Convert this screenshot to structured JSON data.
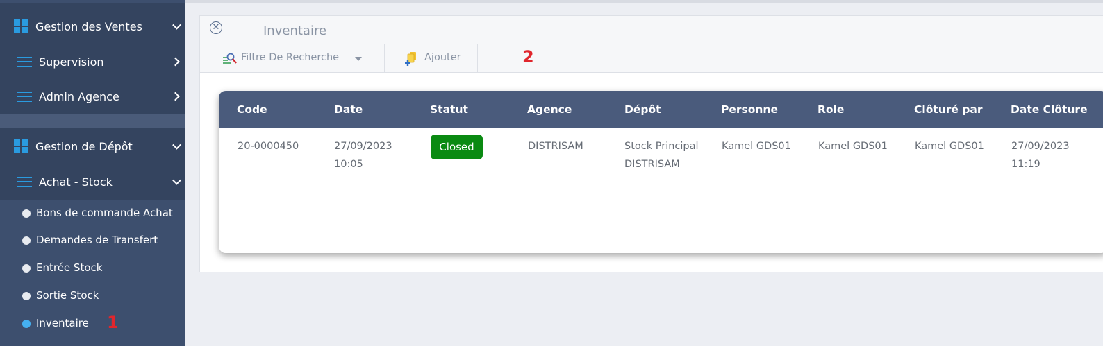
{
  "sidebar": {
    "sections": [
      {
        "label": "Gestion des Ventes",
        "icon": "windows-grid-icon",
        "expanded": true
      },
      {
        "label": "Gestion de Dépôt",
        "icon": "windows-grid-icon",
        "expanded": true
      }
    ],
    "ventes_items": [
      {
        "label": "Supervision",
        "icon": "menu-bars-icon"
      },
      {
        "label": "Admin Agence",
        "icon": "menu-bars-icon"
      }
    ],
    "depot_group": {
      "label": "Achat - Stock",
      "icon": "menu-bars-icon"
    },
    "depot_items": [
      {
        "label": "Bons de commande Achat"
      },
      {
        "label": "Demandes de Transfert"
      },
      {
        "label": "Entrée Stock"
      },
      {
        "label": "Sortie Stock"
      },
      {
        "label": "Inventaire",
        "active": true
      }
    ]
  },
  "annotations": {
    "marker1": "1",
    "marker2": "2"
  },
  "panel": {
    "title": "Inventaire",
    "toolbar": {
      "filter_label": "Filtre De Recherche",
      "add_label": "Ajouter"
    }
  },
  "table": {
    "columns": [
      "Code",
      "Date",
      "Statut",
      "Agence",
      "Dépôt",
      "Personne",
      "Role",
      "Clôturé par",
      "Date Clôture"
    ],
    "rows": [
      {
        "code": "20-0000450",
        "date_line1": "27/09/2023",
        "date_line2": "10:05",
        "statut": "Closed",
        "agence": "DISTRISAM",
        "depot_line1": "Stock Principal",
        "depot_line2": "DISTRISAM",
        "personne": "Kamel GDS01",
        "role": "Kamel GDS01",
        "cloture_par": "Kamel GDS01",
        "date_cloture_line1": "27/09/2023",
        "date_cloture_line2": "11:19"
      }
    ]
  },
  "colors": {
    "sidebar_bg": "#3d4f6e",
    "icon_accent": "#2a9be0",
    "table_header": "#4a5b7c",
    "status_closed": "#0a8a12",
    "marker": "#e0262d"
  }
}
